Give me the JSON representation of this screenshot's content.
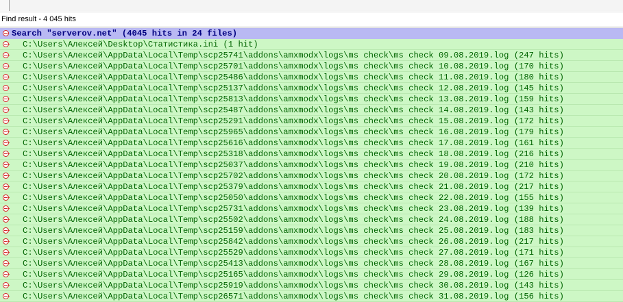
{
  "panel": {
    "title": "Find result - 4 045 hits"
  },
  "search": {
    "label": "Search \"serverov.net\" (4045 hits in 24 files)"
  },
  "files": [
    "C:\\Users\\Алексей\\Desktop\\Статистика.ini (1 hit)",
    "C:\\Users\\Алексей\\AppData\\Local\\Temp\\scp25741\\addons\\amxmodx\\logs\\ms check\\ms check 09.08.2019.log (247 hits)",
    "C:\\Users\\Алексей\\AppData\\Local\\Temp\\scp25701\\addons\\amxmodx\\logs\\ms check\\ms check 10.08.2019.log (170 hits)",
    "C:\\Users\\Алексей\\AppData\\Local\\Temp\\scp25486\\addons\\amxmodx\\logs\\ms check\\ms check 11.08.2019.log (180 hits)",
    "C:\\Users\\Алексей\\AppData\\Local\\Temp\\scp25137\\addons\\amxmodx\\logs\\ms check\\ms check 12.08.2019.log (145 hits)",
    "C:\\Users\\Алексей\\AppData\\Local\\Temp\\scp25813\\addons\\amxmodx\\logs\\ms check\\ms check 13.08.2019.log (159 hits)",
    "C:\\Users\\Алексей\\AppData\\Local\\Temp\\scp25487\\addons\\amxmodx\\logs\\ms check\\ms check 14.08.2019.log (143 hits)",
    "C:\\Users\\Алексей\\AppData\\Local\\Temp\\scp25291\\addons\\amxmodx\\logs\\ms check\\ms check 15.08.2019.log (172 hits)",
    "C:\\Users\\Алексей\\AppData\\Local\\Temp\\scp25965\\addons\\amxmodx\\logs\\ms check\\ms check 16.08.2019.log (179 hits)",
    "C:\\Users\\Алексей\\AppData\\Local\\Temp\\scp25616\\addons\\amxmodx\\logs\\ms check\\ms check 17.08.2019.log (161 hits)",
    "C:\\Users\\Алексей\\AppData\\Local\\Temp\\scp25318\\addons\\amxmodx\\logs\\ms check\\ms check 18.08.2019.log (216 hits)",
    "C:\\Users\\Алексей\\AppData\\Local\\Temp\\scp25037\\addons\\amxmodx\\logs\\ms check\\ms check 19.08.2019.log (210 hits)",
    "C:\\Users\\Алексей\\AppData\\Local\\Temp\\scp25702\\addons\\amxmodx\\logs\\ms check\\ms check 20.08.2019.log (172 hits)",
    "C:\\Users\\Алексей\\AppData\\Local\\Temp\\scp25379\\addons\\amxmodx\\logs\\ms check\\ms check 21.08.2019.log (217 hits)",
    "C:\\Users\\Алексей\\AppData\\Local\\Temp\\scp25050\\addons\\amxmodx\\logs\\ms check\\ms check 22.08.2019.log (155 hits)",
    "C:\\Users\\Алексей\\AppData\\Local\\Temp\\scp25731\\addons\\amxmodx\\logs\\ms check\\ms check 23.08.2019.log (139 hits)",
    "C:\\Users\\Алексей\\AppData\\Local\\Temp\\scp25502\\addons\\amxmodx\\logs\\ms check\\ms check 24.08.2019.log (188 hits)",
    "C:\\Users\\Алексей\\AppData\\Local\\Temp\\scp25159\\addons\\amxmodx\\logs\\ms check\\ms check 25.08.2019.log (183 hits)",
    "C:\\Users\\Алексей\\AppData\\Local\\Temp\\scp25842\\addons\\amxmodx\\logs\\ms check\\ms check 26.08.2019.log (217 hits)",
    "C:\\Users\\Алексей\\AppData\\Local\\Temp\\scp25529\\addons\\amxmodx\\logs\\ms check\\ms check 27.08.2019.log (171 hits)",
    "C:\\Users\\Алексей\\AppData\\Local\\Temp\\scp25413\\addons\\amxmodx\\logs\\ms check\\ms check 28.08.2019.log (167 hits)",
    "C:\\Users\\Алексей\\AppData\\Local\\Temp\\scp25165\\addons\\amxmodx\\logs\\ms check\\ms check 29.08.2019.log (126 hits)",
    "C:\\Users\\Алексей\\AppData\\Local\\Temp\\scp25919\\addons\\amxmodx\\logs\\ms check\\ms check 30.08.2019.log (143 hits)",
    "C:\\Users\\Алексей\\AppData\\Local\\Temp\\scp26571\\addons\\amxmodx\\logs\\ms check\\ms check 31.08.2019.log (156 hits)"
  ],
  "colors": {
    "search_row_bg": "#b9b9f3",
    "file_row_bg": "#cdf7c5",
    "search_text": "#000080",
    "file_text": "#006400",
    "fold_marker": "#d42020"
  },
  "icons": {
    "fold": "collapse-minus-icon"
  }
}
